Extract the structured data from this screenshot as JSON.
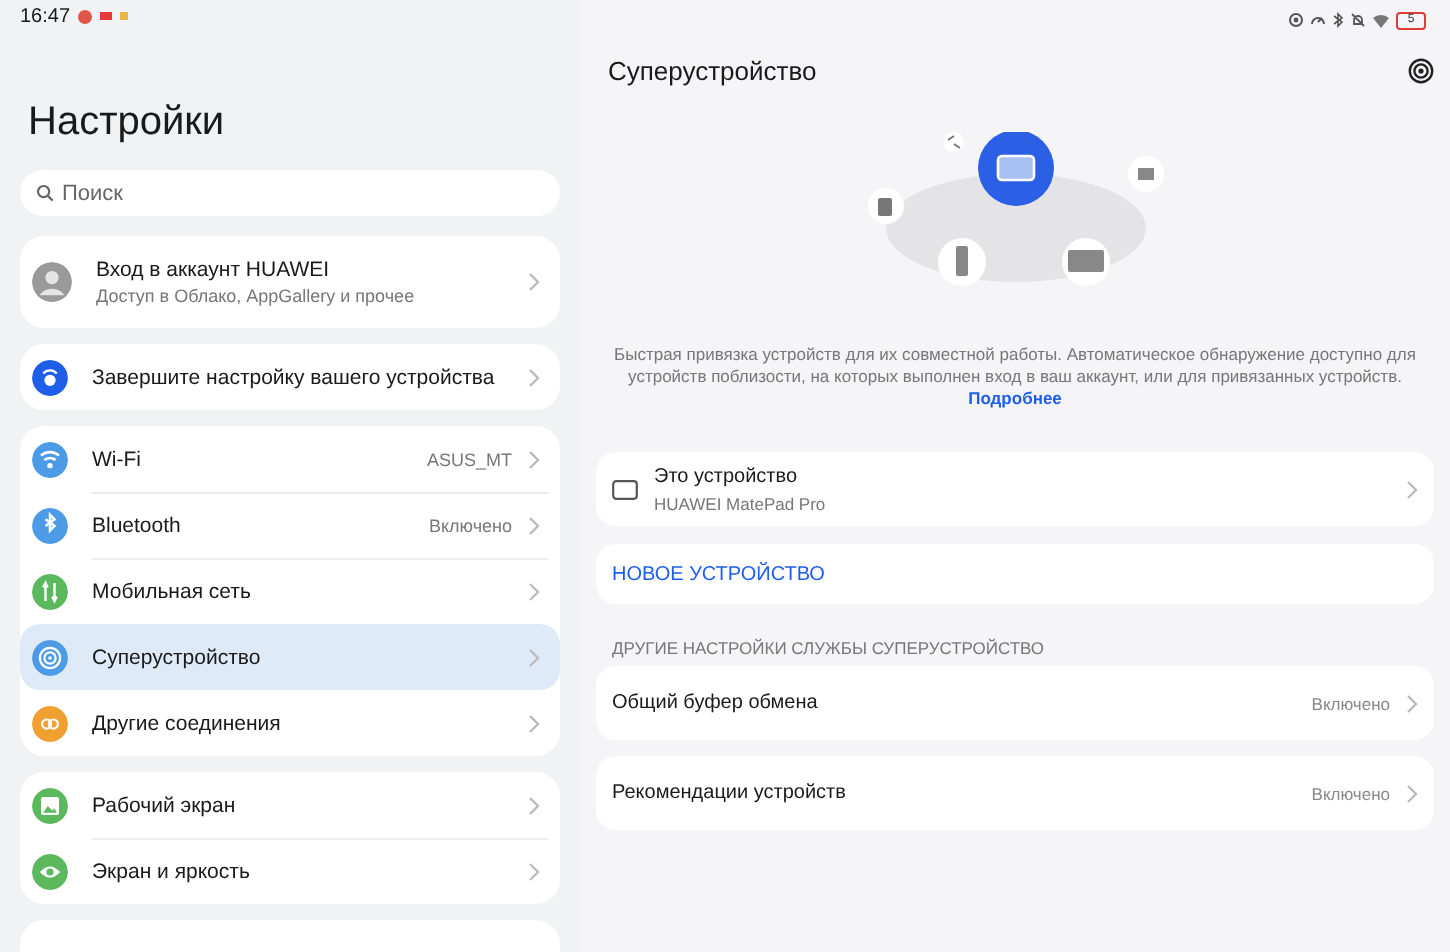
{
  "status_bar": {
    "time": "16:47",
    "battery": "5"
  },
  "sidebar": {
    "title": "Настройки",
    "search": {
      "placeholder": "Поиск"
    },
    "groups": [
      {
        "items": [
          {
            "kind": "account",
            "label": "Вход в аккаунт HUAWEI",
            "subtitle": "Доступ в Облако, AppGallery и прочее",
            "selected": false
          }
        ]
      },
      {
        "items": [
          {
            "kind": "setting",
            "label": "Завершите настройку вашего устройства",
            "color": "#1f5ee8",
            "selected": false
          }
        ]
      },
      {
        "items": [
          {
            "kind": "setting",
            "label": "Wi-Fi",
            "value": "ASUS_MT",
            "color": "#4d9be6",
            "selected": false
          },
          {
            "kind": "setting",
            "label": "Bluetooth",
            "value": "Включено",
            "color": "#4d9be6",
            "selected": false
          },
          {
            "kind": "setting",
            "label": "Мобильная сеть",
            "color": "#5cb85c",
            "selected": false
          },
          {
            "kind": "setting",
            "label": "Суперустройство",
            "color": "#4d9be6",
            "selected": true
          },
          {
            "kind": "setting",
            "label": "Другие соединения",
            "color": "#f0a030",
            "selected": false
          }
        ]
      },
      {
        "items": [
          {
            "kind": "setting",
            "label": "Рабочий экран",
            "color": "#5cb85c",
            "selected": false
          },
          {
            "kind": "setting",
            "label": "Экран и яркость",
            "color": "#5cb85c",
            "selected": false
          }
        ]
      }
    ]
  },
  "panel": {
    "title": "Суперустройство",
    "description": "Быстрая привязка устройств для их совместной работы. Автоматическое обнаружение доступно для устройств поблизости, на которых выполнен вход в ваш аккаунт, или для привязанных устройств.",
    "more_link": "Подробнее",
    "this_device": {
      "label": "Это устройство",
      "subtitle": "HUAWEI MatePad Pro"
    },
    "new_device": "НОВОЕ УСТРОЙСТВО",
    "section_header": "ДРУГИЕ НАСТРОЙКИ СЛУЖБЫ СУПЕРУСТРОЙСТВО",
    "options": [
      {
        "label": "Общий буфер обмена",
        "value": "Включено"
      },
      {
        "label": "Рекомендации устройств",
        "value": "Включено"
      }
    ]
  }
}
